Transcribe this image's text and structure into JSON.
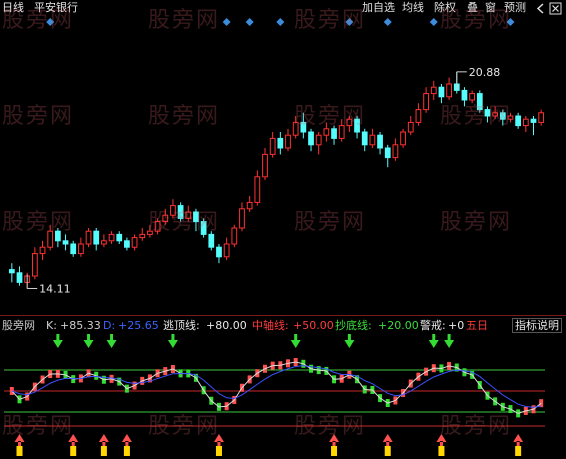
{
  "window": {
    "period": "日线",
    "stock_name": "平安银行"
  },
  "toolbar": {
    "buttons": [
      {
        "label": "加自选",
        "name": "add-favorite-button"
      },
      {
        "label": "均线",
        "name": "moving-average-button"
      },
      {
        "label": "除权",
        "name": "ex-rights-button"
      },
      {
        "label": "叠",
        "name": "overlay-button"
      },
      {
        "label": "窗",
        "name": "window-button"
      },
      {
        "label": "预测",
        "name": "forecast-button"
      }
    ],
    "chevron_icon": "chevron-left-icon",
    "close_icon": "close-box-icon"
  },
  "watermark": "股旁网",
  "price_chart": {
    "high_label": "20.88",
    "low_label": "14.11",
    "up_color": "#ff3232",
    "down_color": "#54fcfc",
    "marker_color": "#3c8cdc"
  },
  "indicator": {
    "name": "股旁网",
    "k_label": "K:",
    "k_value": "+85.33",
    "d_label": "D:",
    "d_value": "+25.65",
    "escape_label": "逃顶线:",
    "escape_value": "+80.00",
    "mid_label": "中轴线:",
    "mid_value": "+50.00",
    "bottom_label": "抄底线:",
    "bottom_value": "+20.00",
    "alert_label": "警戒:",
    "alert_value": "+0",
    "zero_text": "五日",
    "help_button": "指标说明",
    "colors": {
      "escape_line": "#3cc83c",
      "mid_line": "#c82828",
      "bottom_line": "#3cc83c",
      "alert_line": "#c82828",
      "k_line": "#dcdcdc",
      "d_line": "#3c50ff",
      "green_arrow": "#32dc32",
      "red_arrow": "#ff5050",
      "yellow_bar": "#ffd700"
    }
  },
  "chart_data": {
    "type": "candlestick",
    "price_axis": {
      "ylim": [
        13.5,
        22.0
      ]
    },
    "price_high": 20.88,
    "price_low": 14.11,
    "candles": [
      [
        14.7,
        14.6,
        14.9,
        14.3
      ],
      [
        14.6,
        14.3,
        14.8,
        14.2
      ],
      [
        14.3,
        14.5,
        14.6,
        14.1
      ],
      [
        14.5,
        15.2,
        15.4,
        14.4
      ],
      [
        15.2,
        15.4,
        15.6,
        15.0
      ],
      [
        15.4,
        15.9,
        16.1,
        15.3
      ],
      [
        15.9,
        15.6,
        16.0,
        15.4
      ],
      [
        15.6,
        15.5,
        15.8,
        15.3
      ],
      [
        15.5,
        15.2,
        15.6,
        15.1
      ],
      [
        15.2,
        15.5,
        15.7,
        15.1
      ],
      [
        15.5,
        15.9,
        16.0,
        15.4
      ],
      [
        15.9,
        15.5,
        16.0,
        15.3
      ],
      [
        15.5,
        15.6,
        15.8,
        15.4
      ],
      [
        15.6,
        15.8,
        15.9,
        15.5
      ],
      [
        15.8,
        15.6,
        15.9,
        15.5
      ],
      [
        15.6,
        15.4,
        15.7,
        15.3
      ],
      [
        15.4,
        15.7,
        15.8,
        15.3
      ],
      [
        15.7,
        15.8,
        16.0,
        15.6
      ],
      [
        15.8,
        15.9,
        16.1,
        15.7
      ],
      [
        15.9,
        16.2,
        16.3,
        15.8
      ],
      [
        16.2,
        16.4,
        16.6,
        16.1
      ],
      [
        16.4,
        16.7,
        16.9,
        16.3
      ],
      [
        16.7,
        16.3,
        16.8,
        16.2
      ],
      [
        16.3,
        16.5,
        16.7,
        16.2
      ],
      [
        16.5,
        16.2,
        16.6,
        15.9
      ],
      [
        16.2,
        15.8,
        16.3,
        15.7
      ],
      [
        15.8,
        15.4,
        15.9,
        15.3
      ],
      [
        15.4,
        15.1,
        15.5,
        14.9
      ],
      [
        15.1,
        15.5,
        15.7,
        15.0
      ],
      [
        15.5,
        16.0,
        16.1,
        15.4
      ],
      [
        16.0,
        16.6,
        16.8,
        15.9
      ],
      [
        16.6,
        16.8,
        17.0,
        16.5
      ],
      [
        16.8,
        17.6,
        17.8,
        16.7
      ],
      [
        17.6,
        18.3,
        18.5,
        17.5
      ],
      [
        18.3,
        18.8,
        19.0,
        18.2
      ],
      [
        18.8,
        18.5,
        19.0,
        18.3
      ],
      [
        18.5,
        18.9,
        19.1,
        18.4
      ],
      [
        18.9,
        19.3,
        19.5,
        18.8
      ],
      [
        19.3,
        19.0,
        19.6,
        18.8
      ],
      [
        19.0,
        18.6,
        19.1,
        18.4
      ],
      [
        18.6,
        18.9,
        19.0,
        18.3
      ],
      [
        18.9,
        19.1,
        19.3,
        18.7
      ],
      [
        19.1,
        18.8,
        19.2,
        18.6
      ],
      [
        18.8,
        19.2,
        19.4,
        18.7
      ],
      [
        19.2,
        19.4,
        19.5,
        19.0
      ],
      [
        19.4,
        19.0,
        19.5,
        18.8
      ],
      [
        19.0,
        18.6,
        19.1,
        18.4
      ],
      [
        18.6,
        18.9,
        19.1,
        18.5
      ],
      [
        18.9,
        18.5,
        19.0,
        18.3
      ],
      [
        18.5,
        18.2,
        18.6,
        17.9
      ],
      [
        18.2,
        18.6,
        18.8,
        18.1
      ],
      [
        18.6,
        19.0,
        19.1,
        18.5
      ],
      [
        19.0,
        19.3,
        19.5,
        18.9
      ],
      [
        19.3,
        19.7,
        19.9,
        19.2
      ],
      [
        19.7,
        20.2,
        20.4,
        19.6
      ],
      [
        20.2,
        20.4,
        20.6,
        20.0
      ],
      [
        20.4,
        20.1,
        20.5,
        19.9
      ],
      [
        20.1,
        20.5,
        20.7,
        20.0
      ],
      [
        20.5,
        20.3,
        20.88,
        20.2
      ],
      [
        20.3,
        20.0,
        20.4,
        19.8
      ],
      [
        20.0,
        20.2,
        20.3,
        19.9
      ],
      [
        20.2,
        19.7,
        20.3,
        19.6
      ],
      [
        19.7,
        19.5,
        19.8,
        19.3
      ],
      [
        19.5,
        19.6,
        19.8,
        19.4
      ],
      [
        19.6,
        19.4,
        19.7,
        19.2
      ],
      [
        19.4,
        19.5,
        19.6,
        19.3
      ],
      [
        19.5,
        19.2,
        19.6,
        19.1
      ],
      [
        19.2,
        19.4,
        19.5,
        19.0
      ],
      [
        19.4,
        19.3,
        19.5,
        18.9
      ],
      [
        19.3,
        19.6,
        19.7,
        19.2
      ]
    ],
    "diamonds_at": [
      5,
      28,
      31,
      35,
      44,
      49,
      55,
      65
    ]
  }
}
